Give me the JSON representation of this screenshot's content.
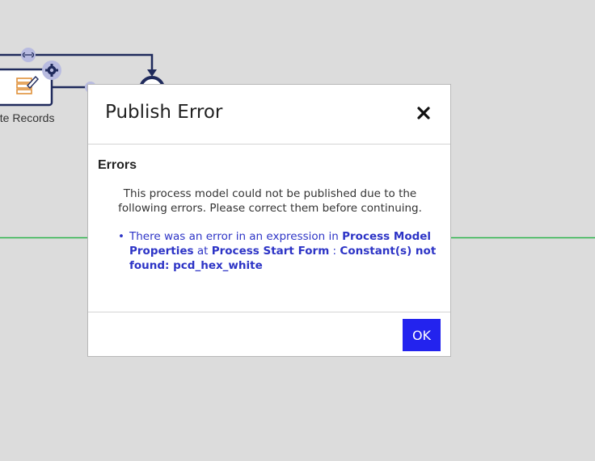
{
  "canvas": {
    "node_label": "rite Records"
  },
  "dialog": {
    "title": "Publish Error",
    "close_icon": "close-x-icon",
    "errors_heading": "Errors",
    "description": "This process model could not be published due to the following errors. Please correct them before continuing.",
    "error_items": [
      {
        "prefix": "There was an error in an expression in ",
        "location": "Process Model Properties",
        "at_text": " at ",
        "form": "Process Start Form",
        "separator": " : ",
        "message": "Constant(s) not found: pcd_hex_white"
      }
    ],
    "ok_label": "OK"
  },
  "colors": {
    "background": "#dcdcdc",
    "flow_line": "#1f2a5c",
    "green_line": "#2ab34a",
    "accent_button": "#2323ee",
    "error_text": "#2d34c6",
    "node_icon": "#e0913a"
  }
}
